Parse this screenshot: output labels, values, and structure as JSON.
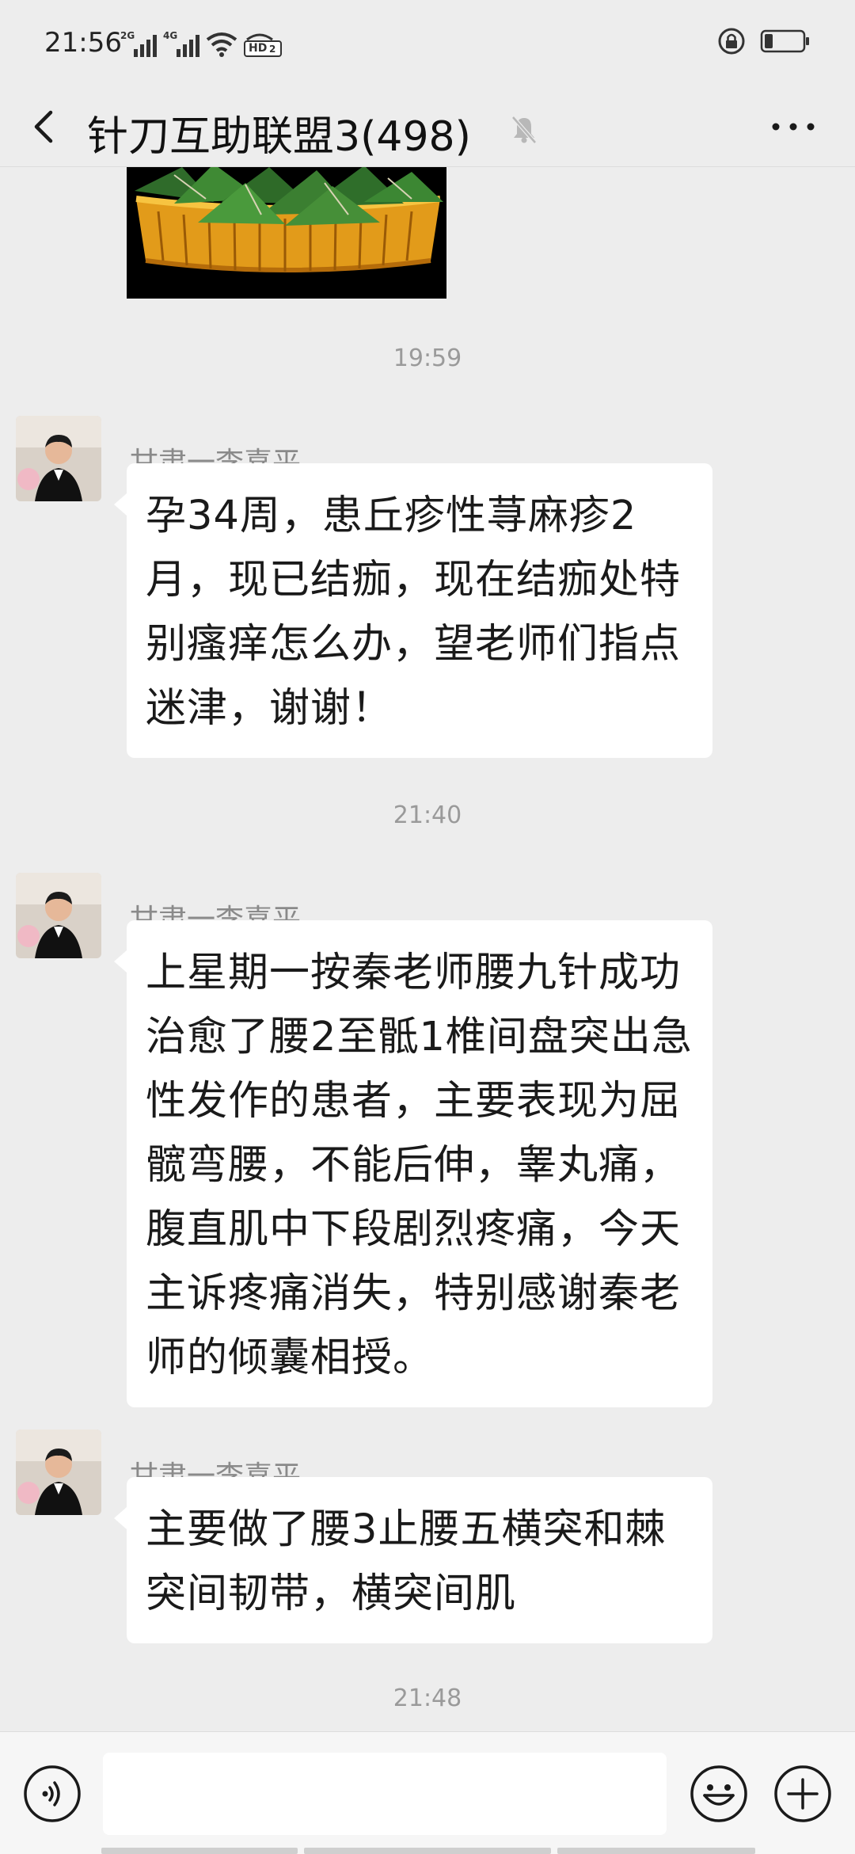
{
  "status_bar": {
    "time": "21:56",
    "network_1": "2G",
    "network_2": "4G",
    "hd_label": "HD",
    "hd_sub": "2"
  },
  "header": {
    "title": "针刀互助联盟3(498)",
    "back_icon": "chevron-left-icon",
    "mute_icon": "bell-muted-icon",
    "more_icon": "more-dots-icon"
  },
  "messages": [
    {
      "type": "timestamp",
      "text": "19:59"
    },
    {
      "type": "message",
      "sender": "甘肃一李喜平",
      "text": "孕34周，患丘疹性荨麻疹2月，现已结痂，现在结痂处特别瘙痒怎么办，望老师们指点迷津，谢谢！"
    },
    {
      "type": "timestamp",
      "text": "21:40"
    },
    {
      "type": "message",
      "sender": "甘肃一李喜平",
      "text": "上星期一按秦老师腰九针成功治愈了腰2至骶1椎间盘突出急性发作的患者，主要表现为屈髋弯腰，不能后伸，睾丸痛，腹直肌中下段剧烈疼痛，今天主诉疼痛消失，特别感谢秦老师的倾囊相授。"
    },
    {
      "type": "message",
      "sender": "甘肃一李喜平",
      "text": "主要做了腰3止腰五横突和棘突间韧带，横突间肌"
    },
    {
      "type": "timestamp",
      "text": "21:48"
    }
  ],
  "input_bar": {
    "placeholder": "",
    "voice_icon": "voice-icon",
    "emoji_icon": "emoji-icon",
    "plus_icon": "plus-icon"
  },
  "colors": {
    "background": "#ededed",
    "bubble": "#ffffff",
    "timestamp": "#9a9a9a",
    "sender": "#8a8a8a"
  }
}
